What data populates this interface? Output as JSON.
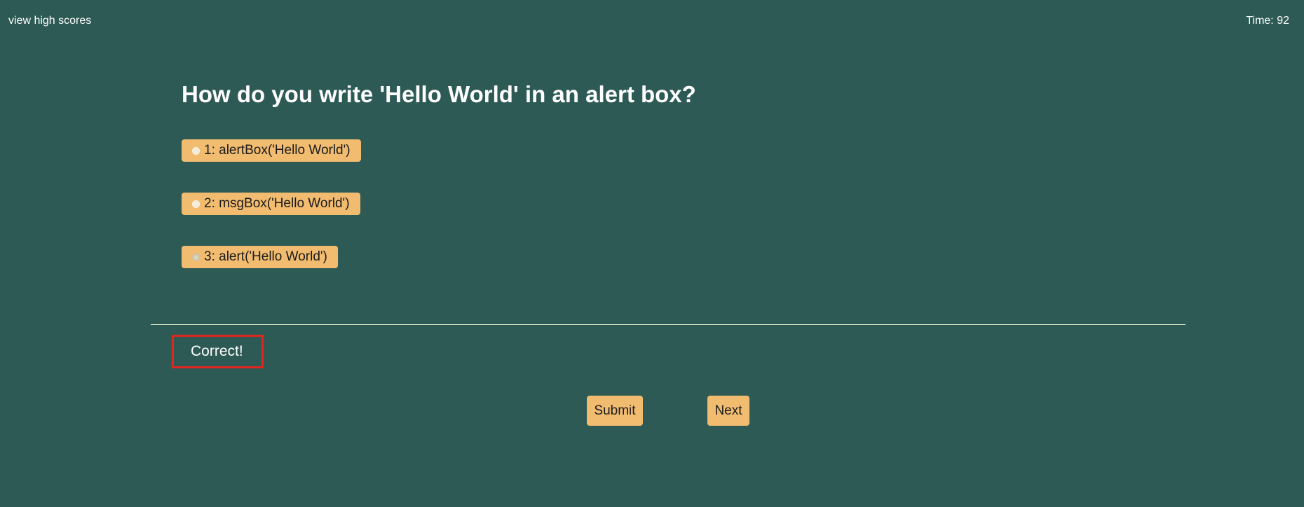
{
  "header": {
    "high_scores_link": "view high scores",
    "timer": "Time: 92"
  },
  "quiz": {
    "question": "How do you write 'Hello World' in an alert box?",
    "choices": [
      {
        "label": "1: alertBox('Hello World')",
        "selected": false
      },
      {
        "label": "2: msgBox('Hello World')",
        "selected": false
      },
      {
        "label": "3: alert('Hello World')",
        "selected": true
      }
    ],
    "feedback": "Correct!"
  },
  "actions": {
    "submit_label": "Submit",
    "next_label": "Next"
  },
  "colors": {
    "background": "#2e5a55",
    "accent": "#f1bc70",
    "feedback_border": "#e0261e"
  }
}
